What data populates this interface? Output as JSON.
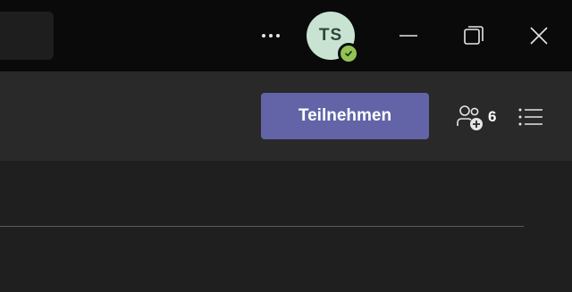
{
  "titlebar": {
    "more_icon": "more-horizontal-icon",
    "avatar": {
      "initials": "TS",
      "bg_color": "#c9e3d3",
      "presence": "available",
      "presence_color": "#92c353"
    },
    "window_controls": [
      "minimize-icon",
      "restore-icon",
      "close-icon"
    ]
  },
  "toolbar": {
    "join_label": "Teilnehmen",
    "join_color": "#6264a7",
    "participants_icon": "people-add-icon",
    "participant_count": "6",
    "list_icon": "list-icon"
  }
}
